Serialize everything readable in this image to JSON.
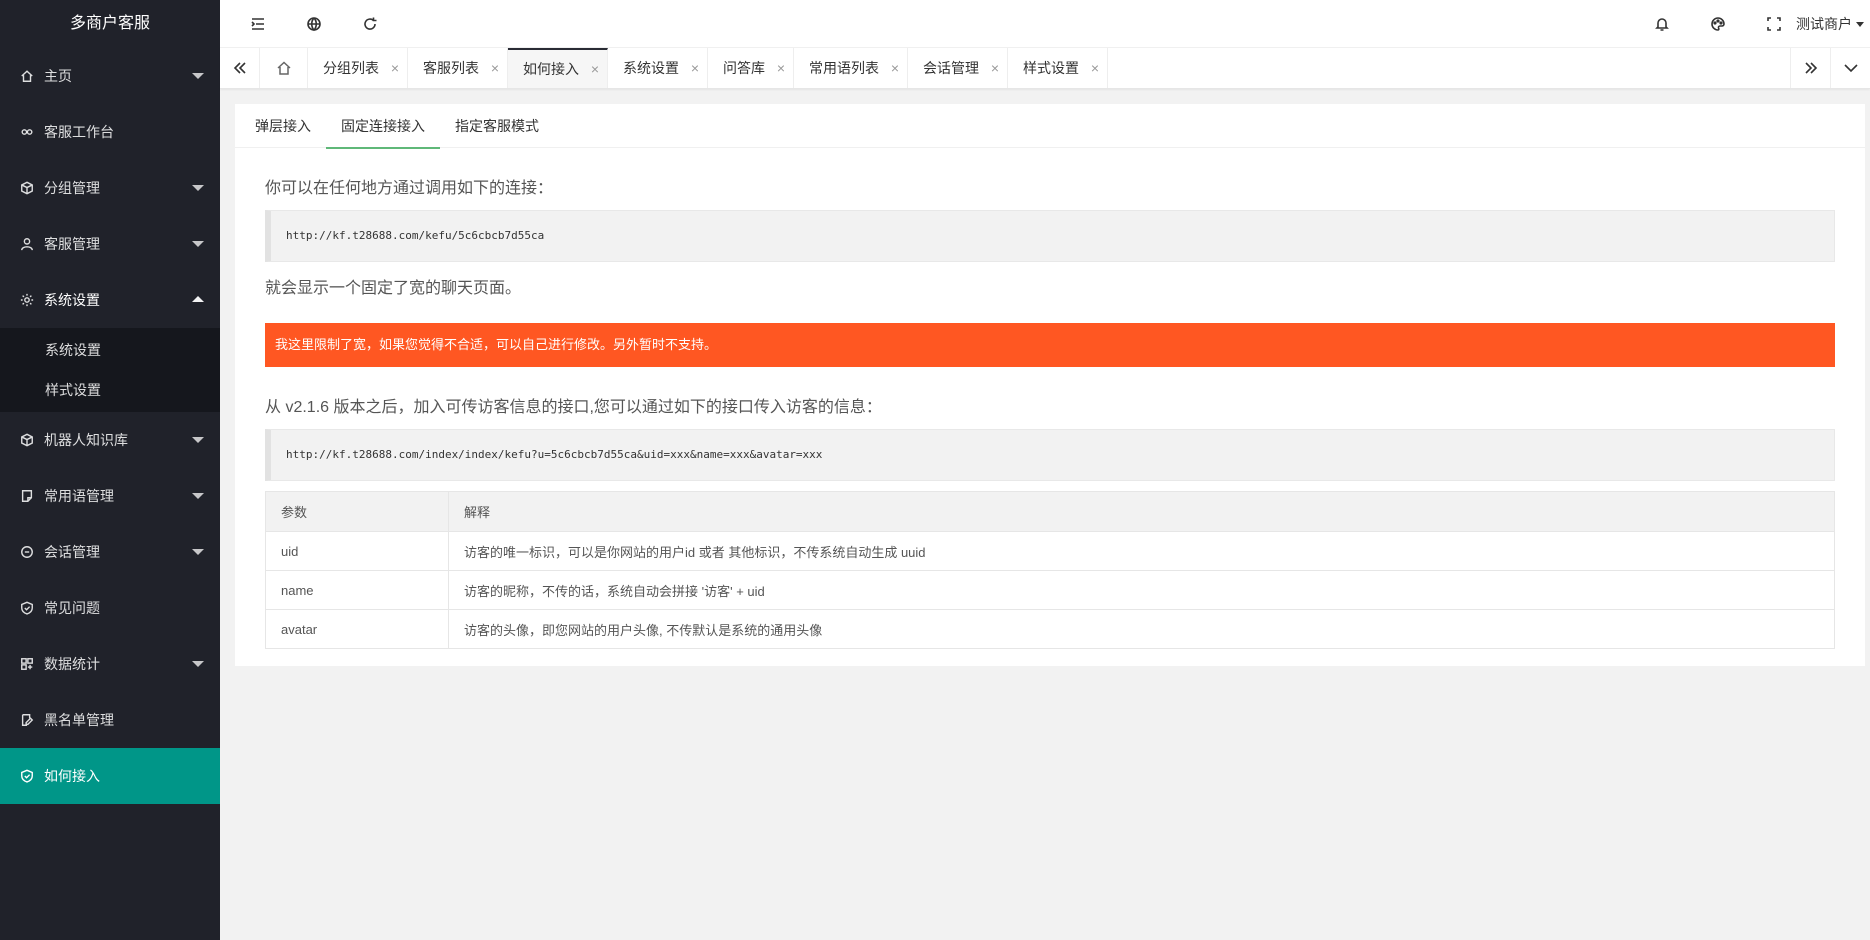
{
  "app": {
    "title": "多商户客服"
  },
  "sidebar": {
    "items": [
      {
        "label": "主页",
        "icon": "home-icon",
        "caret": "down"
      },
      {
        "label": "客服工作台",
        "icon": "link-icon"
      },
      {
        "label": "分组管理",
        "icon": "cube-icon",
        "caret": "down"
      },
      {
        "label": "客服管理",
        "icon": "user-icon",
        "caret": "down"
      },
      {
        "label": "系统设置",
        "icon": "gear-icon",
        "caret": "up"
      },
      {
        "label": "机器人知识库",
        "icon": "cube-icon",
        "caret": "down"
      },
      {
        "label": "常用语管理",
        "icon": "note-icon",
        "caret": "down"
      },
      {
        "label": "会话管理",
        "icon": "chat-icon",
        "caret": "down"
      },
      {
        "label": "常见问题",
        "icon": "shield-icon"
      },
      {
        "label": "数据统计",
        "icon": "app-icon",
        "caret": "down"
      },
      {
        "label": "黑名单管理",
        "icon": "edit-icon"
      },
      {
        "label": "如何接入",
        "icon": "shield-icon",
        "active": true
      }
    ],
    "subitems": [
      "系统设置",
      "样式设置"
    ]
  },
  "header": {
    "user": "测试商户"
  },
  "tabs": [
    {
      "label": "分组列表"
    },
    {
      "label": "客服列表"
    },
    {
      "label": "如何接入",
      "active": true
    },
    {
      "label": "系统设置"
    },
    {
      "label": "问答库"
    },
    {
      "label": "常用语列表"
    },
    {
      "label": "会话管理"
    },
    {
      "label": "样式设置"
    }
  ],
  "tab_close": "×",
  "content": {
    "tabs": [
      "弹层接入",
      "固定连接接入",
      "指定客服模式"
    ],
    "intro": "你可以在任何地方通过调用如下的连接：",
    "url1": "http://kf.t28688.com/kefu/5c6cbcb7d55ca",
    "after": "就会显示一个固定了宽的聊天页面。",
    "alert": "我这里限制了宽，如果您觉得不合适，可以自己进行修改。另外暂时不支持。",
    "intro2": "从 v2.1.6 版本之后，加入可传访客信息的接口,您可以通过如下的接口传入访客的信息：",
    "url2": "http://kf.t28688.com/index/index/kefu?u=5c6cbcb7d55ca&uid=xxx&name=xxx&avatar=xxx",
    "table": {
      "headers": [
        "参数",
        "解释"
      ],
      "rows": [
        [
          "uid",
          "访客的唯一标识，可以是你网站的用户id 或者 其他标识，不传系统自动生成 uuid"
        ],
        [
          "name",
          "访客的昵称，不传的话，系统自动会拼接 '访客' + uid"
        ],
        [
          "avatar",
          "访客的头像，即您网站的用户头像, 不传默认是系统的通用头像"
        ]
      ]
    }
  },
  "colors": {
    "sidebar_bg": "#20222a",
    "active_green": "#009688",
    "alert_orange": "#ff5722",
    "tab_underline": "#5fb878"
  }
}
